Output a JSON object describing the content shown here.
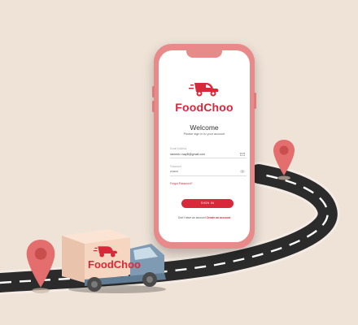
{
  "app": {
    "brand": "FoodChoo",
    "truck_brand": "FoodChoo"
  },
  "login": {
    "title": "Welcome",
    "subtitle": "Please sign in to your account",
    "email_label": "Email Address",
    "email_value": "ramesh.r.sayB@gmail.com",
    "password_label": "Password",
    "password_value": "••••••••",
    "forgot_password": "Forgot Password?",
    "sign_in_button": "SIGN IN",
    "no_account_text": "Don't have an account",
    "create_account_link": "Create an account"
  },
  "icons": {
    "email": "mail-icon",
    "password": "eye-icon",
    "logo": "delivery-scooter-icon",
    "pins": "location-pin-icon"
  },
  "colors": {
    "brand_red": "#d8293b",
    "phone_case": "#e88a8a",
    "background": "#efe3d8",
    "road": "#2b2b2b",
    "truck_cab": "#7f9bb3",
    "truck_box": "#f6d6c0",
    "pin": "#e46d6d"
  }
}
